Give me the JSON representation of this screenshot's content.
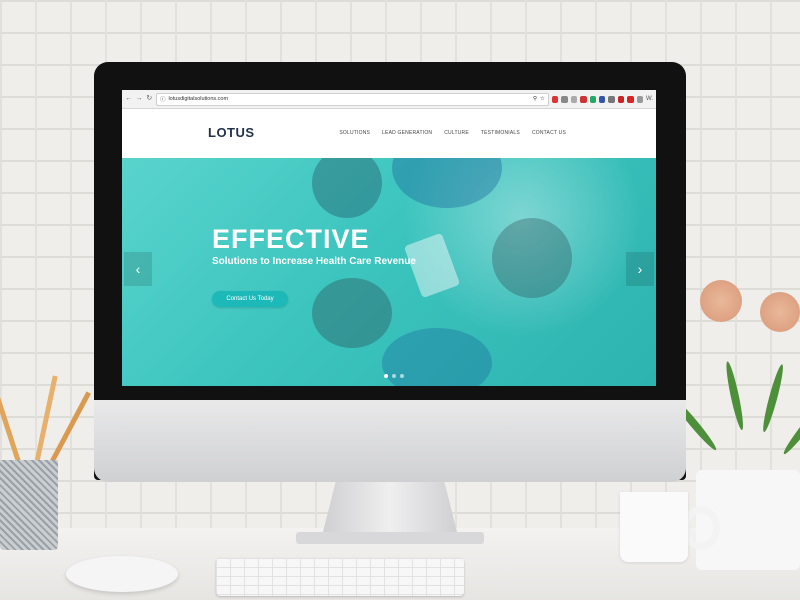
{
  "browser": {
    "back_icon": "back-arrow-icon",
    "forward_icon": "forward-arrow-icon",
    "reload_icon": "reload-icon",
    "url": "lotusdigitalsolutions.com",
    "profile_label": "W."
  },
  "site": {
    "logo": "LOTUS",
    "nav": [
      "SOLUTIONS",
      "LEAD GENERATION",
      "CULTURE",
      "TESTIMONIALS",
      "CONTACT US"
    ]
  },
  "hero": {
    "title": "EFFECTIVE",
    "subtitle": "Solutions to Increase Health Care Revenue",
    "cta_label": "Contact Us Today",
    "prev_icon": "chevron-left-icon",
    "next_icon": "chevron-right-icon",
    "slides": 3,
    "active_slide": 1
  },
  "colors": {
    "accent": "#2fbfb5",
    "hero": "#3cc4be",
    "cta": "#1db9b8",
    "logo": "#22324a"
  }
}
